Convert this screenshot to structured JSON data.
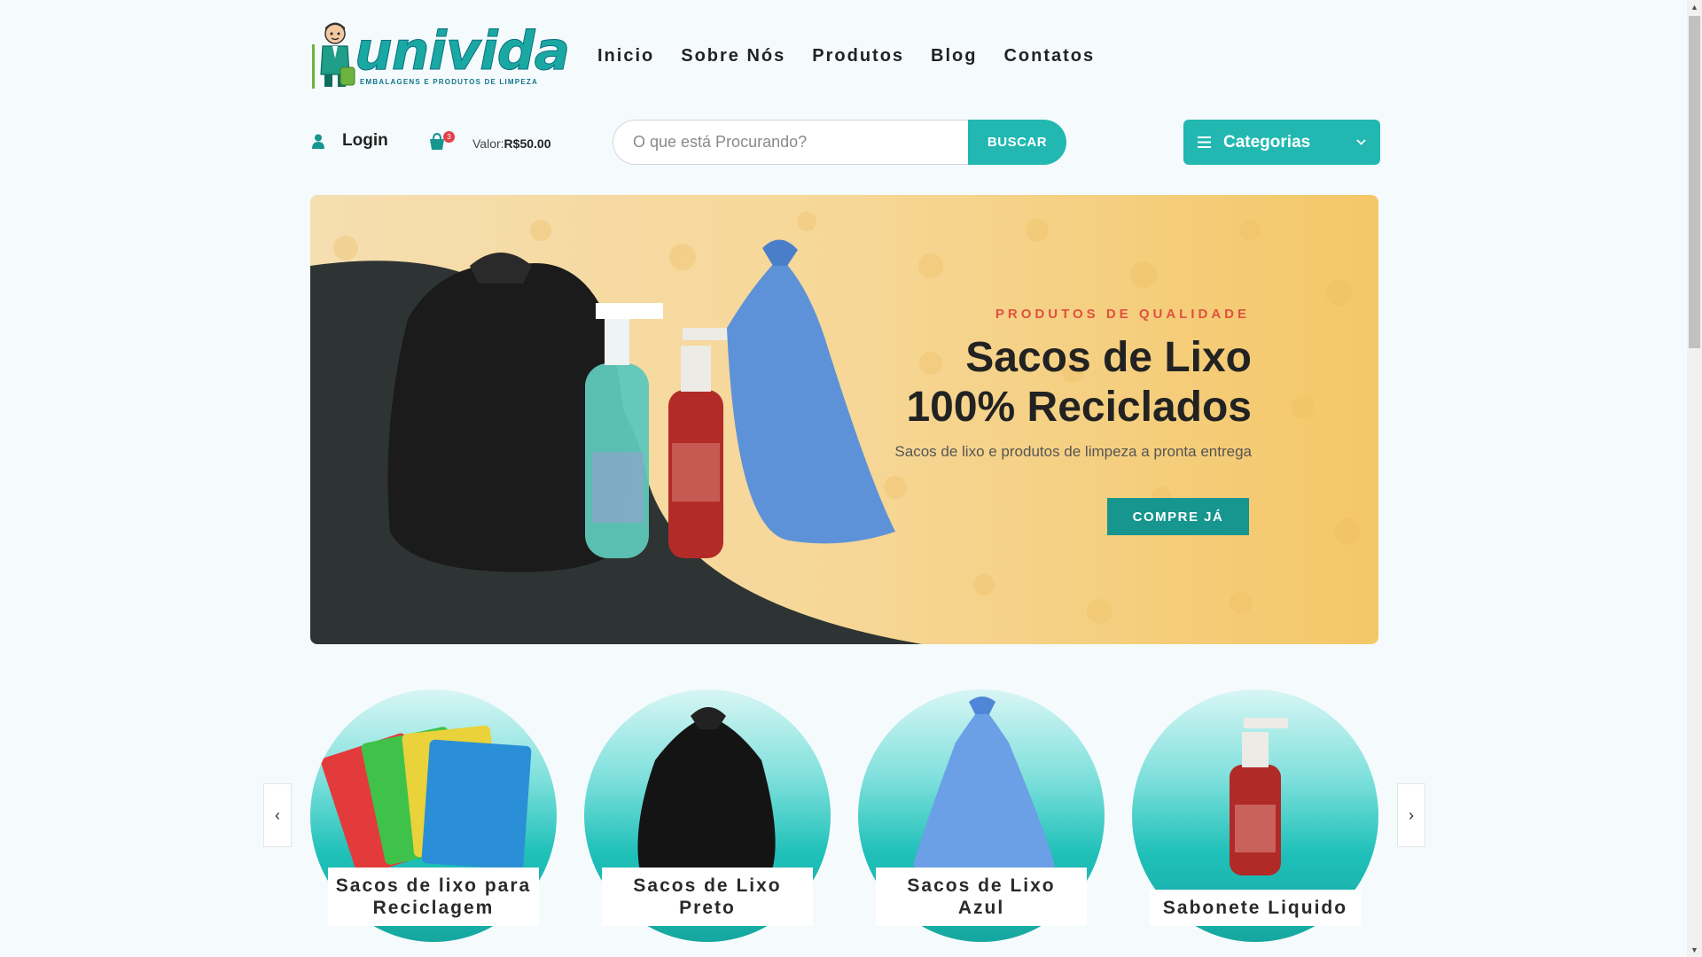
{
  "header": {
    "logo_text": "univida",
    "logo_tagline": "EMBALAGENS E PRODUTOS DE LIMPEZA",
    "nav": [
      "Inicio",
      "Sobre Nós",
      "Produtos",
      "Blog",
      "Contatos"
    ]
  },
  "account": {
    "login_label": "Login",
    "cart_count": "3",
    "cart_value_label": "Valor:",
    "cart_value": "R$50.00"
  },
  "search": {
    "placeholder": "O que está Procurando?",
    "button_label": "BUSCAR"
  },
  "categories_button": {
    "label": "Categorias"
  },
  "hero": {
    "kicker": "PRODUTOS DE QUALIDADE",
    "title_line1": "Sacos de Lixo",
    "title_line2": "100% Reciclados",
    "subtitle": "Sacos de lixo e produtos de limpeza a pronta entrega",
    "cta": "COMPRE JÁ"
  },
  "carousel": {
    "prev": "‹",
    "next": "›",
    "items": [
      {
        "line1": "Sacos de lixo para",
        "line2": "Reciclagem"
      },
      {
        "line1": "Sacos de Lixo Preto",
        "line2": ""
      },
      {
        "line1": "Sacos de Lixo Azul",
        "line2": ""
      },
      {
        "line1": "Sabonete Liquido",
        "line2": ""
      }
    ]
  },
  "colors": {
    "accent": "#22b8b1",
    "accent_dark": "#17958f",
    "kicker": "#e0513f",
    "badge": "#e2404a"
  },
  "icons": [
    "user-icon",
    "cart-icon",
    "menu-icon",
    "chevron-down-icon"
  ]
}
